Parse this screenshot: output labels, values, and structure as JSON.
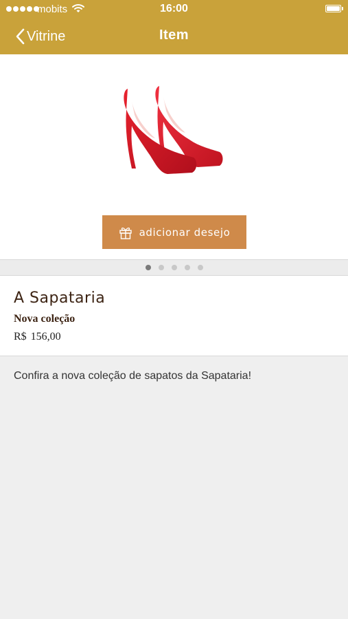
{
  "status_bar": {
    "carrier": "mobits",
    "time": "16:00",
    "battery_level": 1.0,
    "signal_icon": "signal-dots-icon",
    "wifi_icon": "wifi-icon",
    "battery_icon": "battery-icon"
  },
  "nav": {
    "back_label": "Vitrine",
    "title": "Item",
    "back_icon": "chevron-left-icon"
  },
  "product": {
    "image": "red-high-heel-shoes",
    "wish_button_label": "adicionar desejo",
    "wish_icon": "gift-icon",
    "pager": {
      "count": 5,
      "active_index": 0
    },
    "store_name": "A Sapataria",
    "collection": "Nova coleção",
    "price_currency": "R$",
    "price_value": "156,00",
    "description": "Confira a nova coleção de sapatos da Sapataria!"
  },
  "colors": {
    "header": "#c9a23a",
    "wish_button": "#cf8a4a",
    "title_text": "#3d2414",
    "background": "#efefef"
  }
}
